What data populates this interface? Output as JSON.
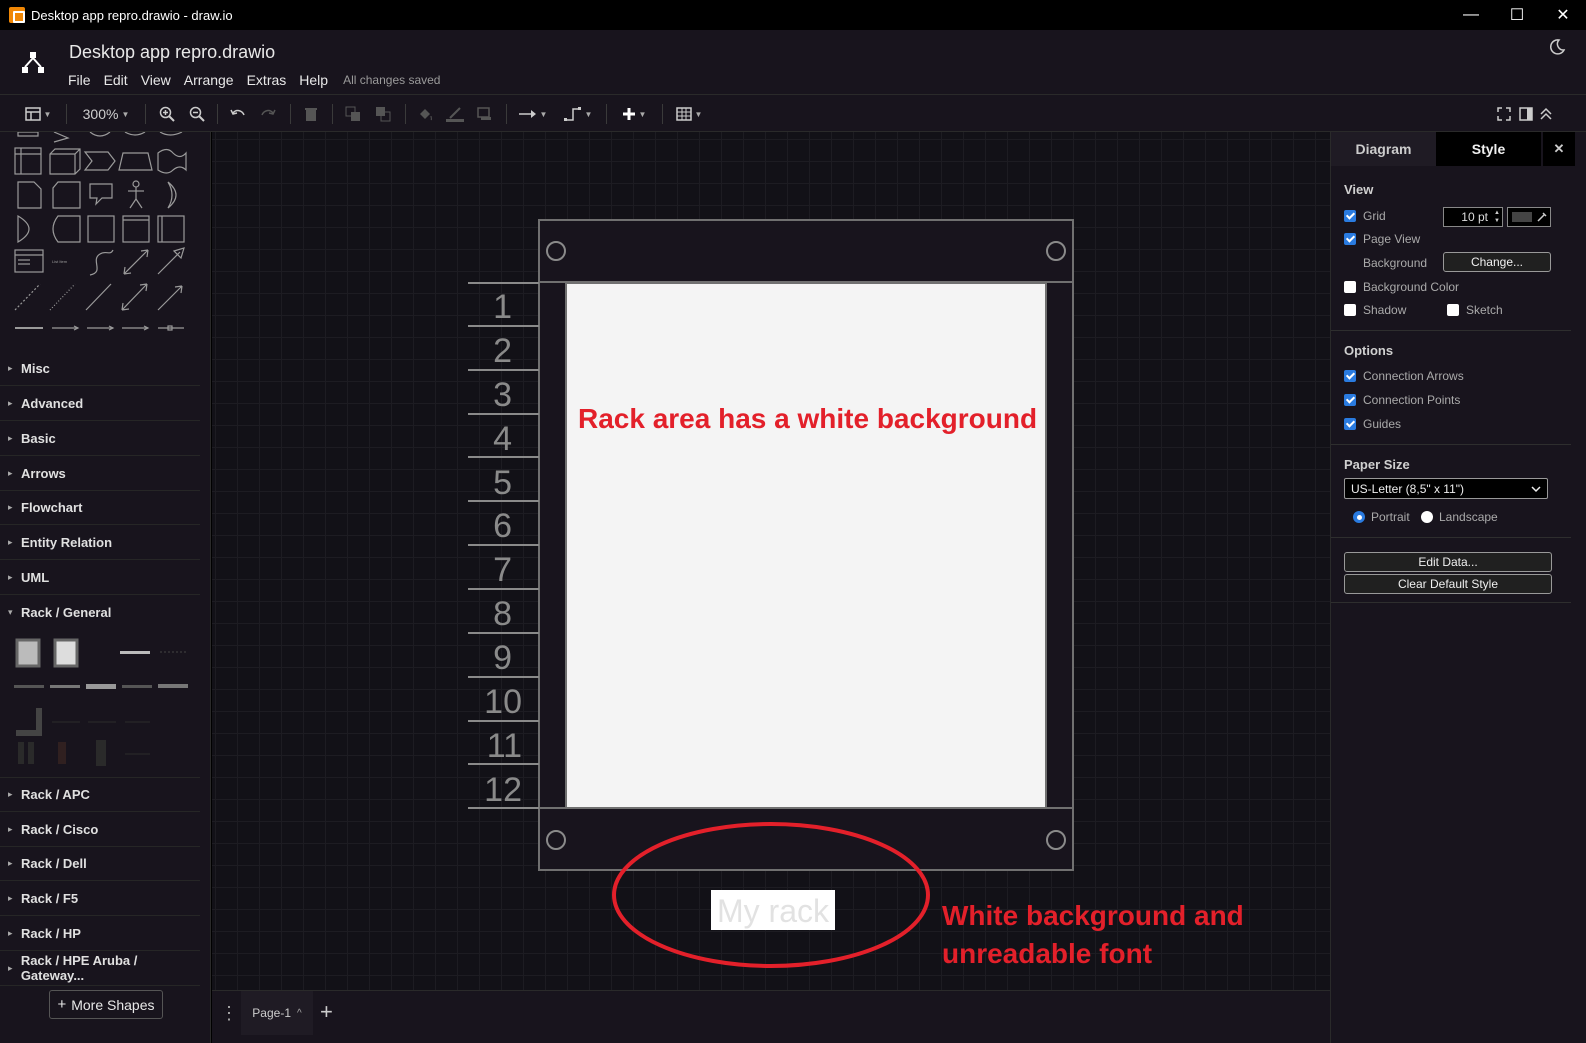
{
  "window": {
    "title": "Desktop app repro.drawio - draw.io",
    "min_glyph": "—",
    "max_glyph": "☐",
    "close_glyph": "✕"
  },
  "header": {
    "filename": "Desktop app repro.drawio",
    "menus": [
      "File",
      "Edit",
      "View",
      "Arrange",
      "Extras",
      "Help"
    ],
    "status": "All changes saved",
    "icons": [
      "drawio-logo-icon",
      "moon-icon"
    ]
  },
  "toolbar": {
    "zoom": "300%",
    "icons": [
      "format-panel-icon",
      "zoom-in-icon",
      "zoom-out-icon",
      "undo-icon",
      "redo-icon",
      "delete-icon",
      "to-front-icon",
      "to-back-icon",
      "fill-color-icon",
      "line-color-icon",
      "shadow-icon",
      "connection-icon",
      "waypoints-icon",
      "insert-icon",
      "table-icon",
      "fullscreen-icon",
      "toggle-panel-icon",
      "collapse-icon"
    ]
  },
  "sidebar": {
    "categories_top": [
      "Misc",
      "Advanced",
      "Basic",
      "Arrows",
      "Flowchart",
      "Entity Relation",
      "UML",
      "Rack / General"
    ],
    "categories_bottom": [
      "Rack / APC",
      "Rack / Cisco",
      "Rack / Dell",
      "Rack / F5",
      "Rack / HP",
      "Rack / HPE Aruba / Gateway..."
    ],
    "more_shapes": "More Shapes",
    "shape_mini_label": "List Item",
    "arrow_collapsed": "▸",
    "arrow_expanded": "▾"
  },
  "canvas": {
    "rack_numbers": [
      "1",
      "2",
      "3",
      "4",
      "5",
      "6",
      "7",
      "8",
      "9",
      "10",
      "11",
      "12"
    ],
    "rack_label": "My rack",
    "annotation_1": "Rack area has a white background",
    "annotation_2_line1": "White background and",
    "annotation_2_line2": "unreadable font",
    "annotation_color": "#e3202a"
  },
  "pagebar": {
    "page_tab": "Page-1",
    "add_glyph": "+",
    "menu_glyph": "⋮",
    "tab_caret": "^"
  },
  "rightpanel": {
    "tabs": [
      "Diagram",
      "Style"
    ],
    "close_glyph": "✕",
    "view_title": "View",
    "grid_label": "Grid",
    "grid_size": "10 pt",
    "page_view_label": "Page View",
    "background_label": "Background",
    "change_button": "Change...",
    "background_color_label": "Background Color",
    "shadow_label": "Shadow",
    "sketch_label": "Sketch",
    "options_title": "Options",
    "connection_arrows_label": "Connection Arrows",
    "connection_points_label": "Connection Points",
    "guides_label": "Guides",
    "paper_size_title": "Paper Size",
    "paper_size_value": "US-Letter (8,5\" x 11\")",
    "portrait_label": "Portrait",
    "landscape_label": "Landscape",
    "edit_data_button": "Edit Data...",
    "clear_default_style_button": "Clear Default Style",
    "checked": {
      "grid": true,
      "page_view": true,
      "background_color": false,
      "shadow": false,
      "sketch": false,
      "connection_arrows": true,
      "connection_points": true,
      "guides": true
    },
    "orientation": "Portrait"
  }
}
